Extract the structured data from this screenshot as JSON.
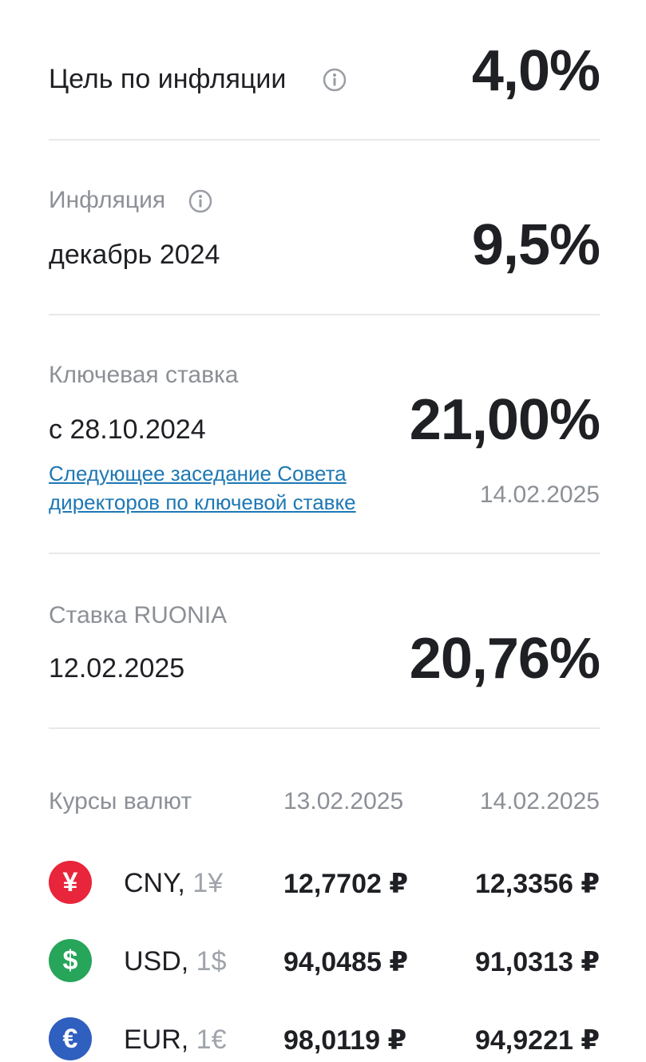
{
  "inflation_target": {
    "label": "Цель по инфляции",
    "value": "4,0%"
  },
  "inflation": {
    "label": "Инфляция",
    "period": "декабрь 2024",
    "value": "9,5%"
  },
  "key_rate": {
    "label": "Ключевая ставка",
    "since": "с 28.10.2024",
    "value": "21,00%",
    "next_meeting_link_line1": "Следующее заседание Совета",
    "next_meeting_link_line2": "директоров по ключевой ставке",
    "next_meeting_date": "14.02.2025"
  },
  "ruonia": {
    "label": "Ставка RUONIA",
    "date": "12.02.2025",
    "value": "20,76%"
  },
  "rates": {
    "title": "Курсы валют",
    "date1": "13.02.2025",
    "date2": "14.02.2025",
    "rows": [
      {
        "code": "CNY,",
        "unit": " 1¥",
        "symbol": "¥",
        "color": "#e8253a",
        "rate1": "12,7702 ₽",
        "rate2": "12,3356 ₽"
      },
      {
        "code": "USD,",
        "unit": " 1$",
        "symbol": "$",
        "color": "#27a55a",
        "rate1": "94,0485 ₽",
        "rate2": "91,0313 ₽"
      },
      {
        "code": "EUR,",
        "unit": " 1€",
        "symbol": "€",
        "color": "#2f5fbf",
        "rate1": "98,0119 ₽",
        "rate2": "94,9221 ₽"
      }
    ]
  },
  "icons": {
    "info": "info-icon"
  }
}
